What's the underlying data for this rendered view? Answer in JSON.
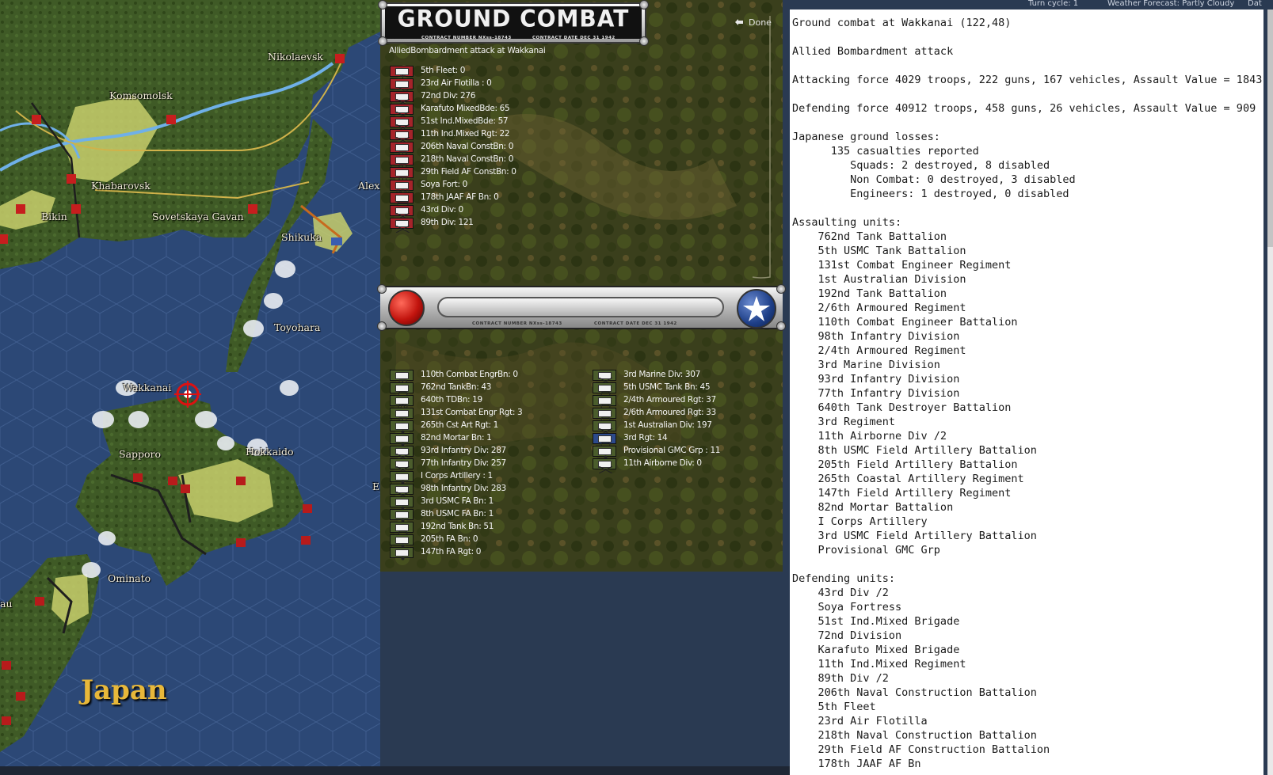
{
  "topbar": {
    "turn_cycle": "Turn cycle: 1",
    "weather": "Weather Forecast: Partly Cloudy",
    "date_label": "Dat"
  },
  "map": {
    "cities": [
      "Nikolaevsk",
      "Komsomolsk",
      "Khabarovsk",
      "Alexa",
      "Bikin",
      "Sovetskaya Gavan",
      "Shikuka",
      "Toyohara",
      "Wakkanai",
      "Sapporo",
      "Hokkaido",
      "Ominato",
      "E",
      "au"
    ],
    "region_label": "Japan",
    "colors": {
      "sea": "#2d4a78",
      "land": "#3e5426",
      "controlled_land": "#c9cf6a",
      "river": "#6fb0e8",
      "road": "#d0b24a"
    }
  },
  "combat": {
    "title": "GROUND COMBAT",
    "contract_number": "CONTRACT NUMBER   NXss-18743",
    "contract_date": "CONTRACT DATE  DEC  31  1942",
    "done_label": "Done",
    "subtitle": "AlliedBombardment attack at Wakkanai",
    "japanese_units": [
      {
        "label": "5th Fleet: 0",
        "icon": "naval-icon"
      },
      {
        "label": "23rd Air Flotilla : 0",
        "icon": "air-icon"
      },
      {
        "label": "72nd Div: 276",
        "icon": "infantry-icon"
      },
      {
        "label": "Karafuto MixedBde: 65",
        "icon": "infantry-icon"
      },
      {
        "label": "51st Ind.MixedBde: 57",
        "icon": "infantry-icon"
      },
      {
        "label": "11th Ind.Mixed Rgt: 22",
        "icon": "infantry-icon"
      },
      {
        "label": "206th Naval ConstBn: 0",
        "icon": "engineer-icon"
      },
      {
        "label": "218th Naval ConstBn: 0",
        "icon": "engineer-icon"
      },
      {
        "label": "29th Field AF ConstBn: 0",
        "icon": "engineer-icon"
      },
      {
        "label": "Soya Fort: 0",
        "icon": "fort-icon"
      },
      {
        "label": "178th JAAF AF Bn: 0",
        "icon": "base-icon"
      },
      {
        "label": "43rd Div: 0",
        "icon": "infantry-icon"
      },
      {
        "label": "89th Div: 121",
        "icon": "infantry-icon"
      }
    ],
    "allied_units_col1": [
      {
        "label": "110th Combat EngrBn: 0",
        "icon": "engineer-icon"
      },
      {
        "label": "762nd TankBn: 43",
        "icon": "armor-icon"
      },
      {
        "label": "640th TDBn: 19",
        "icon": "tank-destroyer-icon"
      },
      {
        "label": "131st Combat Engr Rgt: 3",
        "icon": "engineer-icon"
      },
      {
        "label": "265th Cst Art Rgt: 1",
        "icon": "artillery-icon"
      },
      {
        "label": "82nd Mortar Bn: 1",
        "icon": "artillery-icon"
      },
      {
        "label": "93rd Infantry Div: 287",
        "icon": "infantry-icon"
      },
      {
        "label": "77th Infantry Div: 257",
        "icon": "infantry-icon"
      },
      {
        "label": "I Corps Artillery : 1",
        "icon": "artillery-icon"
      },
      {
        "label": "98th Infantry Div: 283",
        "icon": "infantry-icon"
      },
      {
        "label": "3rd USMC FA Bn: 1",
        "icon": "artillery-icon"
      },
      {
        "label": "8th USMC FA Bn: 1",
        "icon": "artillery-icon"
      },
      {
        "label": "192nd Tank Bn: 51",
        "icon": "armor-icon"
      },
      {
        "label": "205th FA Bn: 0",
        "icon": "artillery-icon"
      },
      {
        "label": "147th FA Rgt: 0",
        "icon": "artillery-icon"
      }
    ],
    "allied_units_col2": [
      {
        "label": "3rd Marine Div: 307",
        "icon": "infantry-icon",
        "selected": false
      },
      {
        "label": "5th USMC Tank Bn: 45",
        "icon": "armor-icon",
        "selected": false
      },
      {
        "label": "2/4th Armoured Rgt: 37",
        "icon": "armor-icon",
        "selected": false
      },
      {
        "label": "2/6th Armoured Rgt: 33",
        "icon": "armor-icon",
        "selected": false
      },
      {
        "label": "1st Australian Div: 197",
        "icon": "infantry-icon",
        "selected": false
      },
      {
        "label": "3rd Rgt: 14",
        "icon": "armor-icon",
        "selected": true
      },
      {
        "label": "Provisional GMC Grp : 11",
        "icon": "artillery-icon",
        "selected": false
      },
      {
        "label": "11th Airborne Div: 0",
        "icon": "infantry-icon",
        "selected": false
      }
    ]
  },
  "log": {
    "lines": [
      "Ground combat at Wakkanai (122,48)",
      "",
      "Allied Bombardment attack",
      "",
      "Attacking force 4029 troops, 222 guns, 167 vehicles, Assault Value = 1843",
      "",
      "Defending force 40912 troops, 458 guns, 26 vehicles, Assault Value = 909",
      "",
      "Japanese ground losses:",
      "      135 casualties reported",
      "         Squads: 2 destroyed, 8 disabled",
      "         Non Combat: 0 destroyed, 3 disabled",
      "         Engineers: 1 destroyed, 0 disabled",
      "",
      "Assaulting units:",
      "    762nd Tank Battalion",
      "    5th USMC Tank Battalion",
      "    131st Combat Engineer Regiment",
      "    1st Australian Division",
      "    192nd Tank Battalion",
      "    2/6th Armoured Regiment",
      "    110th Combat Engineer Battalion",
      "    98th Infantry Division",
      "    2/4th Armoured Regiment",
      "    3rd Marine Division",
      "    93rd Infantry Division",
      "    77th Infantry Division",
      "    640th Tank Destroyer Battalion",
      "    3rd Regiment",
      "    11th Airborne Div /2",
      "    8th USMC Field Artillery Battalion",
      "    205th Field Artillery Battalion",
      "    265th Coastal Artillery Regiment",
      "    147th Field Artillery Regiment",
      "    82nd Mortar Battalion",
      "    I Corps Artillery",
      "    3rd USMC Field Artillery Battalion",
      "    Provisional GMC Grp",
      "",
      "Defending units:",
      "    43rd Div /2",
      "    Soya Fortress",
      "    51st Ind.Mixed Brigade",
      "    72nd Division",
      "    Karafuto Mixed Brigade",
      "    11th Ind.Mixed Regiment",
      "    89th Div /2",
      "    206th Naval Construction Battalion",
      "    5th Fleet",
      "    23rd Air Flotilla",
      "    218th Naval Construction Battalion",
      "    29th Field AF Construction Battalion",
      "    178th JAAF AF Bn"
    ]
  }
}
